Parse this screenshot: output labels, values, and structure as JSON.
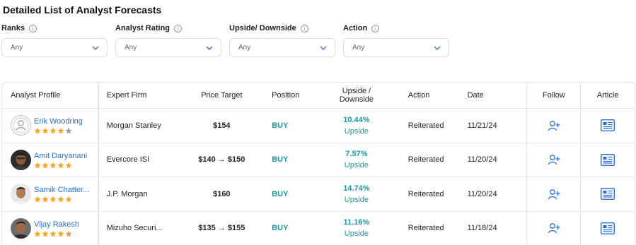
{
  "page": {
    "title": "Detailed List of Analyst Forecasts"
  },
  "filters": [
    {
      "label": "Ranks",
      "value": "Any"
    },
    {
      "label": "Analyst Rating",
      "value": "Any"
    },
    {
      "label": "Upside/ Downside",
      "value": "Any"
    },
    {
      "label": "Action",
      "value": "Any"
    }
  ],
  "table": {
    "headers": {
      "analyst_profile": "Analyst Profile",
      "expert_firm": "Expert Firm",
      "price_target": "Price Target",
      "position": "Position",
      "upside_line1": "Upside /",
      "upside_line2": "Downside",
      "action": "Action",
      "date": "Date",
      "follow": "Follow",
      "article": "Article"
    },
    "rows": [
      {
        "analyst": "Erik Woodring",
        "rating": 4,
        "firm": "Morgan Stanley",
        "price_target": "$154",
        "position": "BUY",
        "upside": "10.44%",
        "direction": "Upside",
        "action": "Reiterated",
        "date": "11/21/24"
      },
      {
        "analyst": "Amit Daryanani",
        "rating": 5,
        "firm": "Evercore ISI",
        "price_target": "$140 → $150",
        "position": "BUY",
        "upside": "7.57%",
        "direction": "Upside",
        "action": "Reiterated",
        "date": "11/20/24"
      },
      {
        "analyst": "Samik Chatter...",
        "rating": 5,
        "firm": "J.P. Morgan",
        "price_target": "$160",
        "position": "BUY",
        "upside": "14.74%",
        "direction": "Upside",
        "action": "Reiterated",
        "date": "11/20/24"
      },
      {
        "analyst": "Vijay Rakesh",
        "rating": 4.5,
        "firm": "Mizuho Securi...",
        "price_target": "$135 → $155",
        "position": "BUY",
        "upside": "11.16%",
        "direction": "Upside",
        "action": "Reiterated",
        "date": "11/18/24"
      }
    ]
  },
  "colors": {
    "accent_teal": "#1a9aa0",
    "link_blue": "#2a6fd6",
    "star_gold": "#f5a623",
    "star_empty": "#9e9e9e"
  },
  "icons": {
    "info": "info-icon",
    "dropdown": "chevron-down-icon",
    "follow": "add-user-icon",
    "article": "article-icon"
  }
}
